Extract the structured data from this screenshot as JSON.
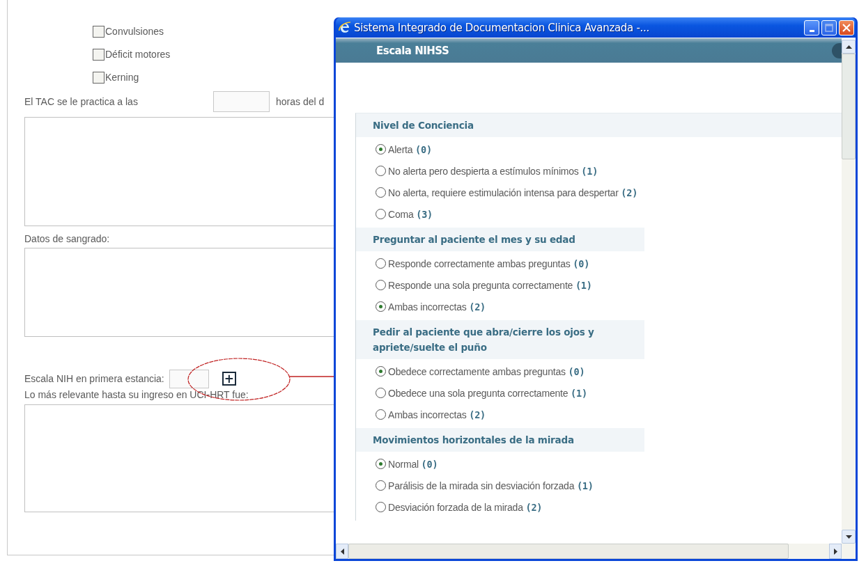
{
  "form": {
    "symptoms": [
      {
        "label": "Convulsiones",
        "checked": false
      },
      {
        "label": "Déficit motores",
        "checked": false
      },
      {
        "label": "Kerning",
        "checked": false
      }
    ],
    "tac": {
      "label": "El TAC se le practica a las",
      "after": "horas del d"
    },
    "bleeding_label": "Datos de sangrado:",
    "nih": {
      "label": "Escala NIH en primera estancia:",
      "button": "+"
    },
    "relevant_label": "Lo más relevante hasta su ingreso en UCI-HRT fue:"
  },
  "popup": {
    "title": "Sistema Integrado de Documentacion Clinica Avanzada -...",
    "header": "Escala NIHSS",
    "sections": [
      {
        "title": "Nivel de Conciencia",
        "options": [
          {
            "label": "Alerta",
            "score": "(0)",
            "selected": true
          },
          {
            "label": "No alerta pero despierta a estímulos mínimos",
            "score": "(1)",
            "selected": false
          },
          {
            "label": "No alerta, requiere estimulación intensa para despertar",
            "score": "(2)",
            "selected": false
          },
          {
            "label": "Coma",
            "score": "(3)",
            "selected": false
          }
        ]
      },
      {
        "title": "Preguntar al paciente el mes y su edad",
        "options": [
          {
            "label": "Responde correctamente ambas preguntas",
            "score": "(0)",
            "selected": false
          },
          {
            "label": "Responde una sola pregunta correctamente",
            "score": "(1)",
            "selected": false
          },
          {
            "label": "Ambas incorrectas",
            "score": "(2)",
            "selected": true
          }
        ]
      },
      {
        "title": "Pedir al paciente que abra/cierre los ojos y apriete/suelte el puño",
        "options": [
          {
            "label": "Obedece correctamente ambas preguntas",
            "score": "(0)",
            "selected": true
          },
          {
            "label": "Obedece una sola pregunta correctamente",
            "score": "(1)",
            "selected": false
          },
          {
            "label": "Ambas incorrectas",
            "score": "(2)",
            "selected": false
          }
        ]
      },
      {
        "title": "Movimientos horizontales de la mirada",
        "options": [
          {
            "label": "Normal",
            "score": "(0)",
            "selected": true
          },
          {
            "label": "Parálisis de la mirada sin desviación forzada",
            "score": "(1)",
            "selected": false
          },
          {
            "label": "Desviación forzada de la mirada",
            "score": "(2)",
            "selected": false
          }
        ]
      }
    ]
  }
}
